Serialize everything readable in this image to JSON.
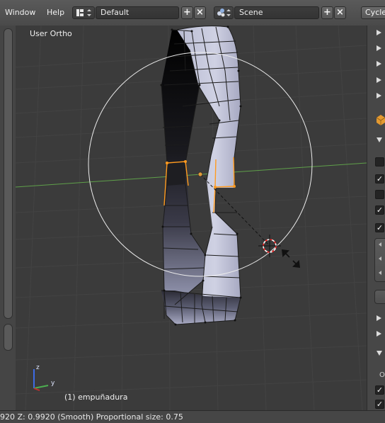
{
  "menu": {
    "window": "Window",
    "help": "Help"
  },
  "screen_layout": {
    "value": "Default"
  },
  "scene": {
    "value": "Scene"
  },
  "render_engine": {
    "label": "Cycles"
  },
  "viewport": {
    "view_name": "User Ortho",
    "object_label": "(1) empuñadura",
    "axes": {
      "z": "z",
      "y": "y"
    }
  },
  "status_bar": {
    "text": "920  Z: 0.9920 (Smooth) Proportional size: 0.75"
  },
  "properties": {
    "partial_label": "O"
  },
  "colors": {
    "selection": "#ff9a1e",
    "grid_x_axis": "#5fa04a",
    "mesh_light": "#c9cbe0",
    "mesh_dark": "#0a0a0a"
  }
}
